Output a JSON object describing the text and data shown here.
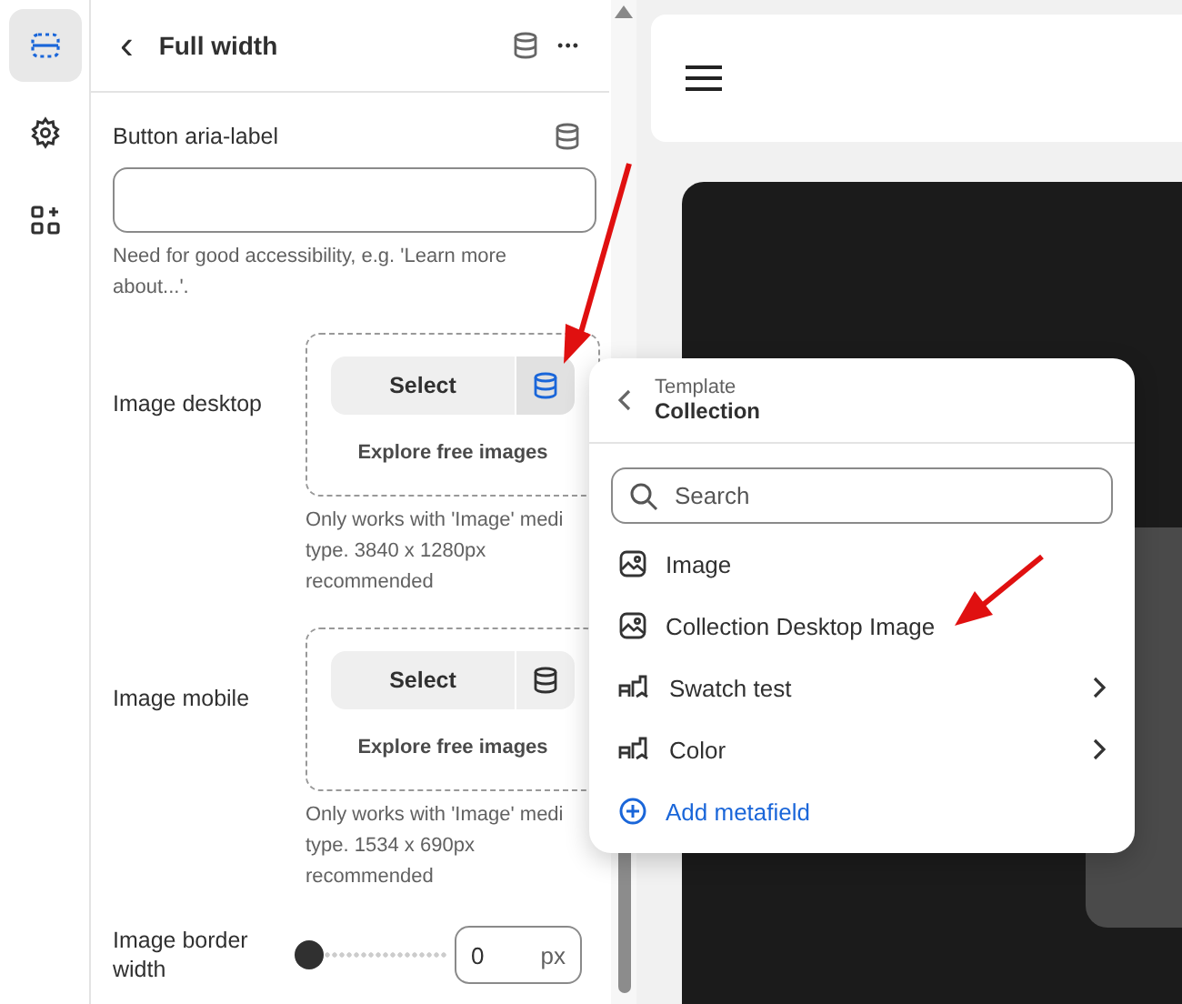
{
  "rail": [
    {
      "kind": "sections",
      "selected": true
    },
    {
      "kind": "settings",
      "selected": false
    },
    {
      "kind": "apps",
      "selected": false
    }
  ],
  "header": {
    "back": "‹",
    "title": "Full width",
    "more": "•••"
  },
  "fields": [
    {
      "kind": "text",
      "label": "Button aria-label",
      "help": [
        "Need for good accessibility, e.g. 'Learn more",
        "about...'."
      ]
    },
    {
      "kind": "image",
      "label": "Image desktop",
      "button": "Select",
      "source_active": true,
      "explore": "Explore free images",
      "help": [
        "Only works with 'Image' medi",
        "type. 3840 x 1280px",
        "recommended"
      ]
    },
    {
      "kind": "image",
      "label": "Image mobile",
      "button": "Select",
      "source_active": false,
      "explore": "Explore free images",
      "help": [
        "Only works with 'Image' medi",
        "type. 1534 x 690px",
        "recommended"
      ]
    },
    {
      "kind": "slider",
      "label": "Image border width",
      "level": 0,
      "value": "0",
      "unit": "px"
    }
  ],
  "popover": {
    "overline": "Template",
    "title": "Collection",
    "search": {
      "placeholder": "Search"
    },
    "items": [
      {
        "kind": "image",
        "label": "Image"
      },
      {
        "kind": "image",
        "label": "Collection Desktop Image"
      },
      {
        "kind": "group",
        "label": "Swatch test"
      },
      {
        "kind": "group",
        "label": "Color"
      },
      {
        "kind": "add",
        "label": "Add metafield"
      }
    ]
  }
}
